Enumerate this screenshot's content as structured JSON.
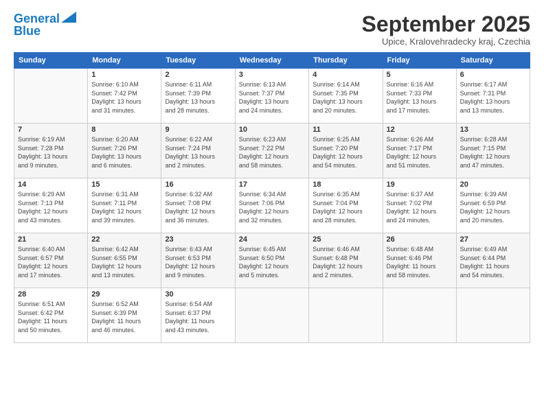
{
  "logo": {
    "line1": "General",
    "line2": "Blue"
  },
  "title": "September 2025",
  "location": "Upice, Kralovehradecky kraj, Czechia",
  "weekdays": [
    "Sunday",
    "Monday",
    "Tuesday",
    "Wednesday",
    "Thursday",
    "Friday",
    "Saturday"
  ],
  "weeks": [
    [
      {
        "day": "",
        "info": ""
      },
      {
        "day": "1",
        "info": "Sunrise: 6:10 AM\nSunset: 7:42 PM\nDaylight: 13 hours\nand 31 minutes."
      },
      {
        "day": "2",
        "info": "Sunrise: 6:11 AM\nSunset: 7:39 PM\nDaylight: 13 hours\nand 28 minutes."
      },
      {
        "day": "3",
        "info": "Sunrise: 6:13 AM\nSunset: 7:37 PM\nDaylight: 13 hours\nand 24 minutes."
      },
      {
        "day": "4",
        "info": "Sunrise: 6:14 AM\nSunset: 7:35 PM\nDaylight: 13 hours\nand 20 minutes."
      },
      {
        "day": "5",
        "info": "Sunrise: 6:16 AM\nSunset: 7:33 PM\nDaylight: 13 hours\nand 17 minutes."
      },
      {
        "day": "6",
        "info": "Sunrise: 6:17 AM\nSunset: 7:31 PM\nDaylight: 13 hours\nand 13 minutes."
      }
    ],
    [
      {
        "day": "7",
        "info": "Sunrise: 6:19 AM\nSunset: 7:28 PM\nDaylight: 13 hours\nand 9 minutes."
      },
      {
        "day": "8",
        "info": "Sunrise: 6:20 AM\nSunset: 7:26 PM\nDaylight: 13 hours\nand 6 minutes."
      },
      {
        "day": "9",
        "info": "Sunrise: 6:22 AM\nSunset: 7:24 PM\nDaylight: 13 hours\nand 2 minutes."
      },
      {
        "day": "10",
        "info": "Sunrise: 6:23 AM\nSunset: 7:22 PM\nDaylight: 12 hours\nand 58 minutes."
      },
      {
        "day": "11",
        "info": "Sunrise: 6:25 AM\nSunset: 7:20 PM\nDaylight: 12 hours\nand 54 minutes."
      },
      {
        "day": "12",
        "info": "Sunrise: 6:26 AM\nSunset: 7:17 PM\nDaylight: 12 hours\nand 51 minutes."
      },
      {
        "day": "13",
        "info": "Sunrise: 6:28 AM\nSunset: 7:15 PM\nDaylight: 12 hours\nand 47 minutes."
      }
    ],
    [
      {
        "day": "14",
        "info": "Sunrise: 6:29 AM\nSunset: 7:13 PM\nDaylight: 12 hours\nand 43 minutes."
      },
      {
        "day": "15",
        "info": "Sunrise: 6:31 AM\nSunset: 7:11 PM\nDaylight: 12 hours\nand 39 minutes."
      },
      {
        "day": "16",
        "info": "Sunrise: 6:32 AM\nSunset: 7:08 PM\nDaylight: 12 hours\nand 36 minutes."
      },
      {
        "day": "17",
        "info": "Sunrise: 6:34 AM\nSunset: 7:06 PM\nDaylight: 12 hours\nand 32 minutes."
      },
      {
        "day": "18",
        "info": "Sunrise: 6:35 AM\nSunset: 7:04 PM\nDaylight: 12 hours\nand 28 minutes."
      },
      {
        "day": "19",
        "info": "Sunrise: 6:37 AM\nSunset: 7:02 PM\nDaylight: 12 hours\nand 24 minutes."
      },
      {
        "day": "20",
        "info": "Sunrise: 6:39 AM\nSunset: 6:59 PM\nDaylight: 12 hours\nand 20 minutes."
      }
    ],
    [
      {
        "day": "21",
        "info": "Sunrise: 6:40 AM\nSunset: 6:57 PM\nDaylight: 12 hours\nand 17 minutes."
      },
      {
        "day": "22",
        "info": "Sunrise: 6:42 AM\nSunset: 6:55 PM\nDaylight: 12 hours\nand 13 minutes."
      },
      {
        "day": "23",
        "info": "Sunrise: 6:43 AM\nSunset: 6:53 PM\nDaylight: 12 hours\nand 9 minutes."
      },
      {
        "day": "24",
        "info": "Sunrise: 6:45 AM\nSunset: 6:50 PM\nDaylight: 12 hours\nand 5 minutes."
      },
      {
        "day": "25",
        "info": "Sunrise: 6:46 AM\nSunset: 6:48 PM\nDaylight: 12 hours\nand 2 minutes."
      },
      {
        "day": "26",
        "info": "Sunrise: 6:48 AM\nSunset: 6:46 PM\nDaylight: 11 hours\nand 58 minutes."
      },
      {
        "day": "27",
        "info": "Sunrise: 6:49 AM\nSunset: 6:44 PM\nDaylight: 11 hours\nand 54 minutes."
      }
    ],
    [
      {
        "day": "28",
        "info": "Sunrise: 6:51 AM\nSunset: 6:42 PM\nDaylight: 11 hours\nand 50 minutes."
      },
      {
        "day": "29",
        "info": "Sunrise: 6:52 AM\nSunset: 6:39 PM\nDaylight: 11 hours\nand 46 minutes."
      },
      {
        "day": "30",
        "info": "Sunrise: 6:54 AM\nSunset: 6:37 PM\nDaylight: 11 hours\nand 43 minutes."
      },
      {
        "day": "",
        "info": ""
      },
      {
        "day": "",
        "info": ""
      },
      {
        "day": "",
        "info": ""
      },
      {
        "day": "",
        "info": ""
      }
    ]
  ]
}
